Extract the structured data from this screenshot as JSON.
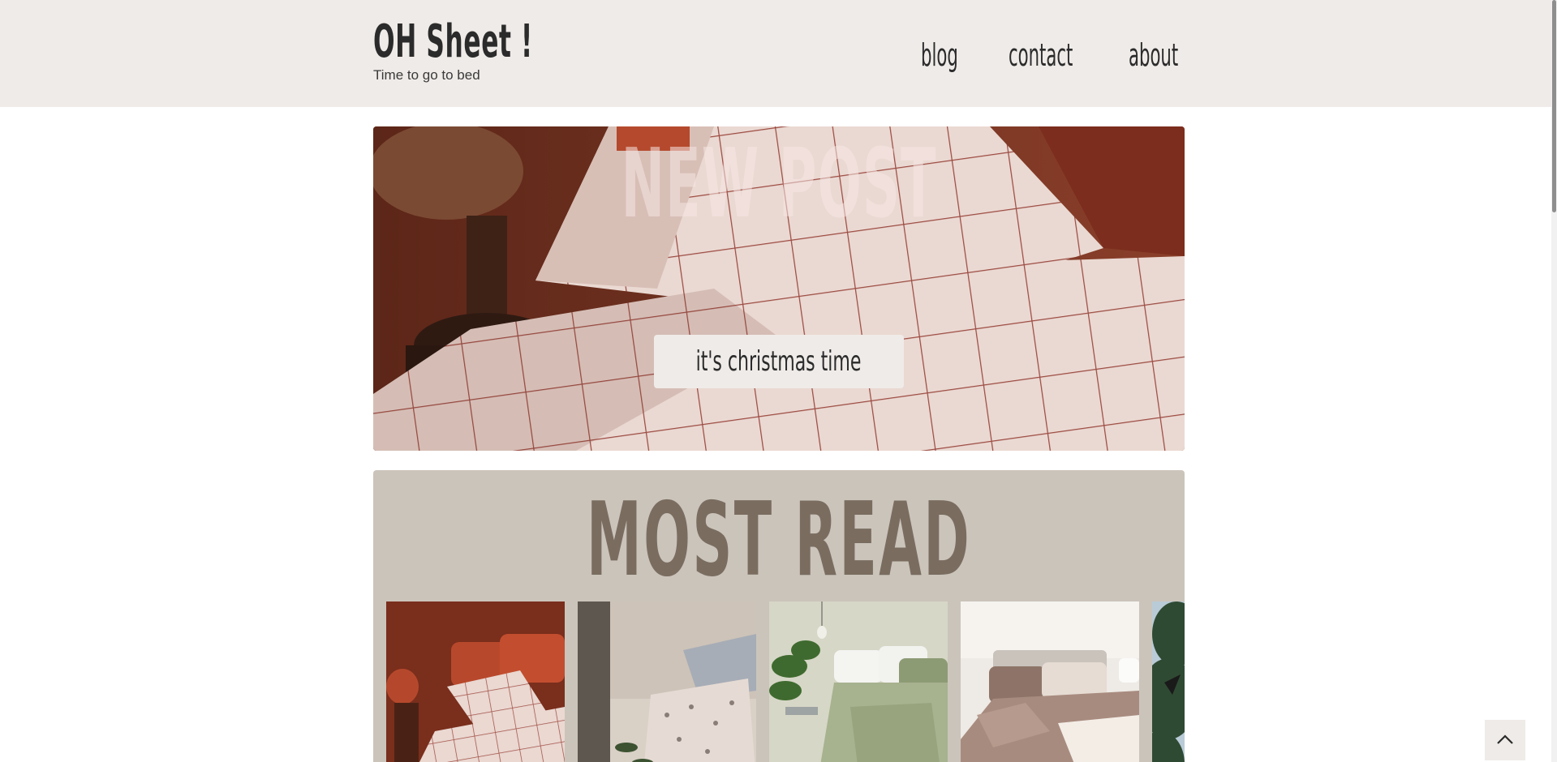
{
  "header": {
    "logo_title": "OH Sheet !",
    "logo_subtitle": "Time to go to bed",
    "nav": [
      {
        "label": "blog"
      },
      {
        "label": "contact"
      },
      {
        "label": "about"
      }
    ]
  },
  "hero": {
    "title": "NEW POST",
    "button_label": "it's christmas time"
  },
  "most_read": {
    "title": "MOST READ",
    "cards": [
      {
        "icon": "bedroom-rust-photo"
      },
      {
        "icon": "bedroom-floral-photo"
      },
      {
        "icon": "bedroom-sage-photo"
      },
      {
        "icon": "bedroom-taupe-photo"
      },
      {
        "icon": "outdoor-trees-photo"
      }
    ]
  },
  "scroll_top": {
    "icon": "chevron-up-icon"
  },
  "colors": {
    "header_bg": "#efebe8",
    "most_read_bg": "#cbc4bb",
    "most_read_text": "#7a6d60",
    "text_dark": "#2b2b2b"
  }
}
